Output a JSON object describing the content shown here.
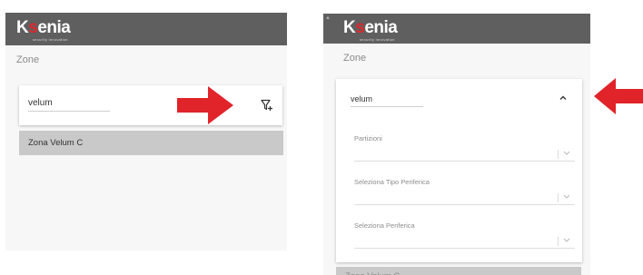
{
  "colors": {
    "header_bg": "#5f5f5f",
    "brand_red": "#e0262c",
    "zone_row_bg": "#c9c9c9",
    "arrow_red": "#e0242a"
  },
  "left_panel": {
    "logo": "Ksenia",
    "logo_tagline": "security innovation",
    "page_title": "Zone",
    "search": {
      "value": "velum"
    },
    "filter_icon": "filter-add-icon",
    "zone_item": "Zona Velum C"
  },
  "right_panel": {
    "logo": "Ksenia",
    "logo_tagline": "security innovation",
    "page_title": "Zone",
    "search": {
      "value": "velum"
    },
    "collapse_icon": "chevron-up-icon",
    "fields": [
      {
        "label": "Partizioni"
      },
      {
        "label": "Seleziona Tipo Periferica"
      },
      {
        "label": "Seleziona Periferica"
      }
    ],
    "zone_item": "Zona Velum C"
  }
}
